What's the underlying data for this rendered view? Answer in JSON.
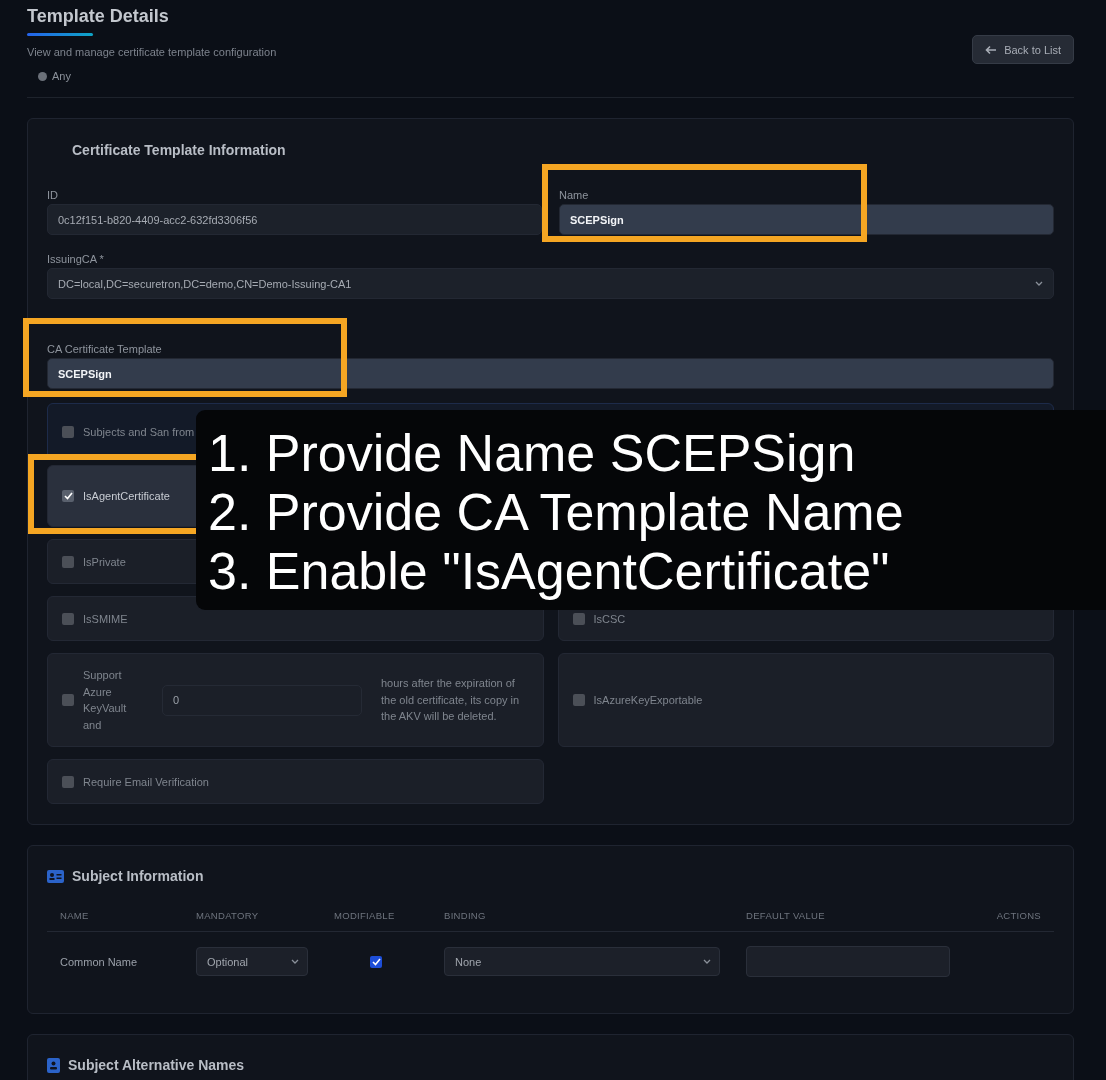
{
  "header": {
    "title": "Template Details",
    "subtitle": "View and manage certificate template configuration",
    "radio": {
      "label": "Any",
      "selected": false
    },
    "back_button": "Back to List"
  },
  "template_info": {
    "title": "Certificate Template Information",
    "id": {
      "label": "ID",
      "value": "0c12f151-b820-4409-acc2-632fd3306f56"
    },
    "name": {
      "label": "Name",
      "value": "SCEPSign",
      "highlighted": true
    },
    "issuing_ca": {
      "label": "IssuingCA *",
      "value": "DC=local,DC=securetron,DC=demo,CN=Demo-Issuing-CA1"
    },
    "ca_template": {
      "label": "CA Certificate Template",
      "value": "SCEPSign",
      "highlighted": true
    },
    "directory_option": {
      "label": "Subjects and San from",
      "checked": false
    },
    "options": [
      {
        "kind": "check",
        "label": "IsAgentCertificate",
        "checked": true,
        "highlighted": true
      },
      {
        "kind": "blank"
      },
      {
        "kind": "check",
        "label": "IsPrivate",
        "checked": false
      },
      {
        "kind": "blank"
      },
      {
        "kind": "check",
        "label": "IsSMIME",
        "checked": false
      },
      {
        "kind": "check",
        "label": "IsCSC",
        "checked": false
      },
      {
        "kind": "check-input",
        "label": "Support Azure KeyVault and",
        "value": "0",
        "suffix": "hours after the expiration of the old certificate, its copy in the AKV will be deleted.",
        "checked": false
      },
      {
        "kind": "check",
        "label": "IsAzureKeyExportable",
        "checked": false
      },
      {
        "kind": "check",
        "label": "Require Email Verification",
        "checked": false
      }
    ]
  },
  "subject_info": {
    "title": "Subject Information",
    "columns": [
      "NAME",
      "MANDATORY",
      "MODIFIABLE",
      "BINDING",
      "DEFAULT VALUE",
      "ACTIONS"
    ],
    "rows": [
      {
        "name": "Common Name",
        "mandatory": "Optional",
        "modifiable": true,
        "binding": "None"
      }
    ]
  },
  "san": {
    "title": "Subject Alternative Names"
  },
  "annotation": {
    "lines": [
      "1. Provide Name SCEPSign",
      "2. Provide CA Template Name",
      "3. Enable \"IsAgentCertificate\""
    ]
  }
}
